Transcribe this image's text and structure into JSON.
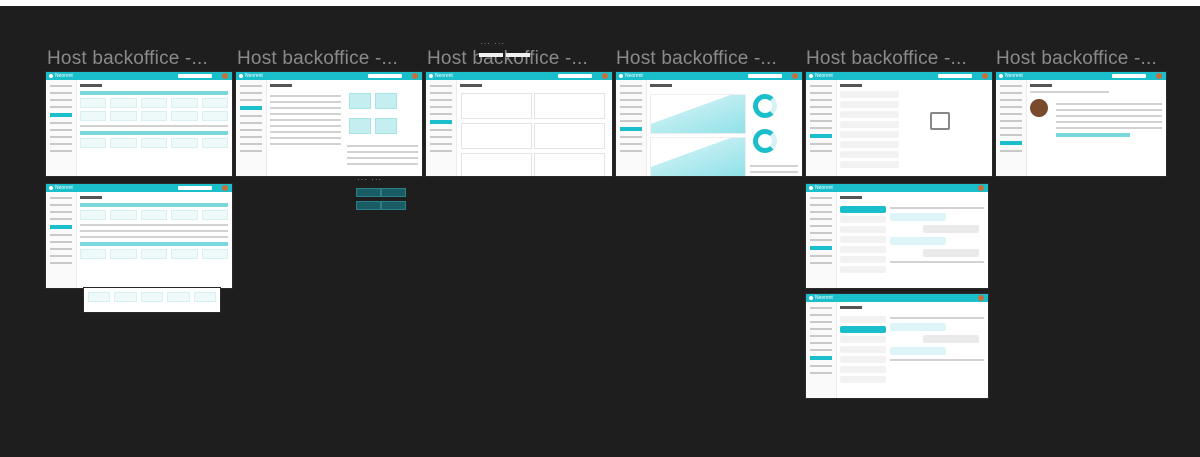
{
  "canvas": {
    "background": "#1e1e1e",
    "accent": "#1bbecb"
  },
  "frames": [
    {
      "title": "Host backoffice -...",
      "brand": "Neorent"
    },
    {
      "title": "Host backoffice -...",
      "brand": "Neorent"
    },
    {
      "title": "Host backoffice -...",
      "brand": "Neorent"
    },
    {
      "title": "Host backoffice -...",
      "brand": "Neorent"
    },
    {
      "title": "Host backoffice -...",
      "brand": "Neorent"
    },
    {
      "title": "Host backoffice -...",
      "brand": "Neorent"
    }
  ]
}
